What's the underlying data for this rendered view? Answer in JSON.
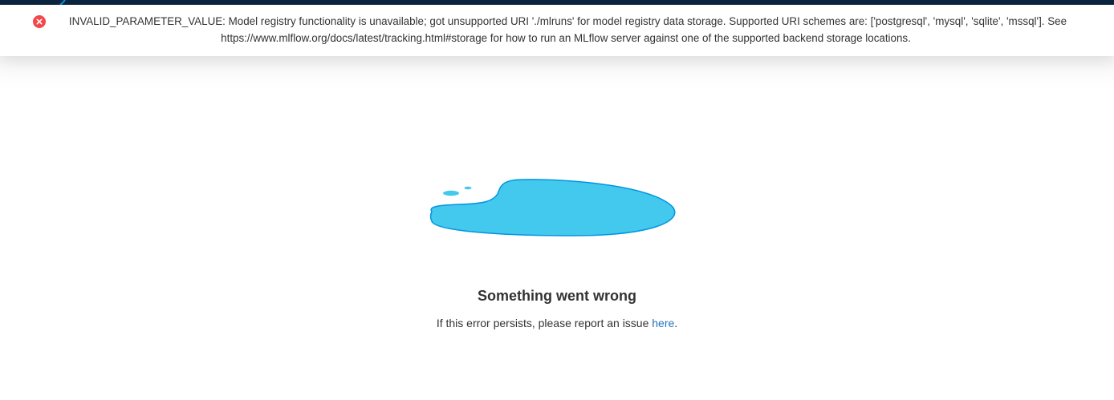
{
  "error_banner": {
    "icon": "close-circle-icon",
    "icon_color": "#f5474a",
    "message": "INVALID_PARAMETER_VALUE: Model registry functionality is unavailable; got unsupported URI './mlruns' for model registry data storage. Supported URI schemes are: ['postgresql', 'mysql', 'sqlite', 'mssql']. See https://www.mlflow.org/docs/latest/tracking.html#storage for how to run an MLflow server against one of the supported backend storage locations."
  },
  "error_page": {
    "illustration": "water-puddle-illustration",
    "title": "Something went wrong",
    "message_prefix": "If this error persists, please report an issue ",
    "link_text": "here",
    "message_suffix": "."
  },
  "colors": {
    "header_bg": "#0b2541",
    "puddle_fill": "#43c9ed",
    "puddle_stroke": "#0194e2",
    "link": "#2374bb",
    "text": "#333333"
  }
}
